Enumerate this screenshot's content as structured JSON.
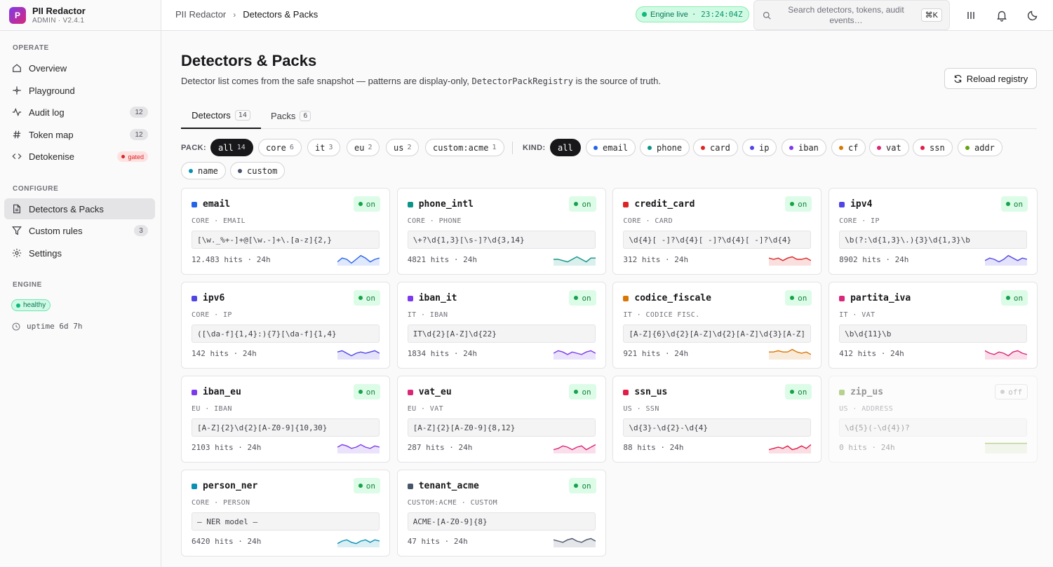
{
  "app": {
    "name": "PII Redactor",
    "version": "ADMIN · V2.4.1",
    "logo_letter": "P"
  },
  "sidebar": {
    "sections": [
      {
        "title": "OPERATE",
        "items": [
          {
            "label": "Overview",
            "icon": "home-icon"
          },
          {
            "label": "Playground",
            "icon": "sparkle-icon"
          },
          {
            "label": "Audit log",
            "icon": "activity-icon",
            "count": "12"
          },
          {
            "label": "Token map",
            "icon": "hash-icon",
            "count": "12"
          },
          {
            "label": "Detokenise",
            "icon": "code-icon",
            "badge": "gated"
          }
        ]
      },
      {
        "title": "CONFIGURE",
        "items": [
          {
            "label": "Detectors & Packs",
            "icon": "file-icon",
            "active": true
          },
          {
            "label": "Custom rules",
            "icon": "filter-icon",
            "count": "3"
          },
          {
            "label": "Settings",
            "icon": "gear-icon"
          }
        ]
      },
      {
        "title": "ENGINE"
      }
    ],
    "engine_status": "healthy",
    "uptime": "uptime 6d 7h"
  },
  "topbar": {
    "breadcrumb": [
      "PII Redactor",
      "Detectors & Packs"
    ],
    "engine_label": "Engine live",
    "engine_time": "· 23:24:04Z",
    "search_placeholder": "Search detectors, tokens, audit events…",
    "search_shortcut": "⌘K"
  },
  "page": {
    "title": "Detectors & Packs",
    "desc_before": "Detector list comes from the safe snapshot — patterns are display-only, ",
    "desc_code": "DetectorPackRegistry",
    "desc_after": " is the source of truth.",
    "reload_label": "Reload registry",
    "tabs": [
      {
        "label": "Detectors",
        "count": "14"
      },
      {
        "label": "Packs",
        "count": "6"
      }
    ]
  },
  "filters": {
    "pack_label": "PACK:",
    "kind_label": "KIND:",
    "packs": [
      {
        "label": "all",
        "count": "14",
        "active": true
      },
      {
        "label": "core",
        "count": "6"
      },
      {
        "label": "it",
        "count": "3"
      },
      {
        "label": "eu",
        "count": "2"
      },
      {
        "label": "us",
        "count": "2"
      },
      {
        "label": "custom:acme",
        "count": "1"
      }
    ],
    "kinds": [
      {
        "label": "all",
        "active": true
      },
      {
        "label": "email",
        "color": "#2563eb"
      },
      {
        "label": "phone",
        "color": "#0d9488"
      },
      {
        "label": "card",
        "color": "#dc2626"
      },
      {
        "label": "ip",
        "color": "#4f46e5"
      },
      {
        "label": "iban",
        "color": "#7c3aed"
      },
      {
        "label": "cf",
        "color": "#d97706"
      },
      {
        "label": "vat",
        "color": "#db2777"
      },
      {
        "label": "ssn",
        "color": "#e11d48"
      },
      {
        "label": "addr",
        "color": "#65a30d"
      },
      {
        "label": "name",
        "color": "#0891b2"
      },
      {
        "label": "custom",
        "color": "#475569"
      }
    ]
  },
  "detectors": [
    {
      "name": "email",
      "meta": "CORE · EMAIL",
      "pattern": "[\\w._%+-]+@[\\w.-]+\\.[a-z]{2,}",
      "hits": "12.483 hits · 24h",
      "status": "on",
      "color": "#2563eb",
      "spark": [
        0.3,
        0.6,
        0.5,
        0.2,
        0.5,
        0.8,
        0.6,
        0.3,
        0.5,
        0.6
      ]
    },
    {
      "name": "phone_intl",
      "meta": "CORE · PHONE",
      "pattern": "\\+?\\d{1,3}[\\s-]?\\d{3,14}",
      "hits": "4821 hits · 24h",
      "status": "on",
      "color": "#0d9488",
      "spark": [
        0.5,
        0.5,
        0.4,
        0.3,
        0.5,
        0.7,
        0.5,
        0.3,
        0.6,
        0.6
      ]
    },
    {
      "name": "credit_card",
      "meta": "CORE · CARD",
      "pattern": "\\d{4}[ -]?\\d{4}[ -]?\\d{4}[ -]?\\d{4}",
      "hits": "312 hits · 24h",
      "status": "on",
      "color": "#dc2626",
      "spark": [
        0.6,
        0.5,
        0.6,
        0.4,
        0.6,
        0.7,
        0.5,
        0.5,
        0.6,
        0.4
      ]
    },
    {
      "name": "ipv4",
      "meta": "CORE · IP",
      "pattern": "\\b(?:\\d{1,3}\\.){3}\\d{1,3}\\b",
      "hits": "8902 hits · 24h",
      "status": "on",
      "color": "#4f46e5",
      "spark": [
        0.4,
        0.6,
        0.5,
        0.3,
        0.5,
        0.8,
        0.6,
        0.4,
        0.6,
        0.5
      ]
    },
    {
      "name": "ipv6",
      "meta": "CORE · IP",
      "pattern": "([\\da-f]{1,4}:){7}[\\da-f]{1,4}",
      "hits": "142 hits · 24h",
      "status": "on",
      "color": "#4f46e5",
      "spark": [
        0.6,
        0.7,
        0.5,
        0.3,
        0.5,
        0.6,
        0.5,
        0.6,
        0.7,
        0.5
      ]
    },
    {
      "name": "iban_it",
      "meta": "IT · IBAN",
      "pattern": "IT\\d{2}[A-Z]\\d{22}",
      "hits": "1834 hits · 24h",
      "status": "on",
      "color": "#7c3aed",
      "spark": [
        0.5,
        0.7,
        0.6,
        0.4,
        0.6,
        0.5,
        0.4,
        0.6,
        0.7,
        0.5
      ]
    },
    {
      "name": "codice_fiscale",
      "meta": "IT · CODICE FISC.",
      "pattern": "[A-Z]{6}\\d{2}[A-Z]\\d{2}[A-Z]\\d{3}[A-Z]",
      "hits": "921 hits · 24h",
      "status": "on",
      "color": "#d97706",
      "spark": [
        0.6,
        0.6,
        0.7,
        0.6,
        0.6,
        0.8,
        0.6,
        0.5,
        0.6,
        0.4
      ]
    },
    {
      "name": "partita_iva",
      "meta": "IT · VAT",
      "pattern": "\\b\\d{11}\\b",
      "hits": "412 hits · 24h",
      "status": "on",
      "color": "#db2777",
      "spark": [
        0.7,
        0.5,
        0.4,
        0.6,
        0.5,
        0.3,
        0.6,
        0.7,
        0.5,
        0.4
      ]
    },
    {
      "name": "iban_eu",
      "meta": "EU · IBAN",
      "pattern": "[A-Z]{2}\\d{2}[A-Z0-9]{10,30}",
      "hits": "2103 hits · 24h",
      "status": "on",
      "color": "#7c3aed",
      "spark": [
        0.5,
        0.7,
        0.6,
        0.4,
        0.5,
        0.7,
        0.5,
        0.4,
        0.6,
        0.5
      ]
    },
    {
      "name": "vat_eu",
      "meta": "EU · VAT",
      "pattern": "[A-Z]{2}[A-Z0-9]{8,12}",
      "hits": "287 hits · 24h",
      "status": "on",
      "color": "#db2777",
      "spark": [
        0.3,
        0.4,
        0.6,
        0.5,
        0.3,
        0.5,
        0.6,
        0.3,
        0.5,
        0.7
      ]
    },
    {
      "name": "ssn_us",
      "meta": "US · SSN",
      "pattern": "\\d{3}-\\d{2}-\\d{4}",
      "hits": "88 hits · 24h",
      "status": "on",
      "color": "#e11d48",
      "spark": [
        0.3,
        0.4,
        0.5,
        0.4,
        0.6,
        0.3,
        0.4,
        0.6,
        0.4,
        0.7
      ]
    },
    {
      "name": "zip_us",
      "meta": "US · ADDRESS",
      "pattern": "\\d{5}(-\\d{4})?",
      "hits": "0 hits · 24h",
      "status": "off",
      "color": "#65a30d",
      "spark": [
        0.8,
        0.8,
        0.8,
        0.8,
        0.8,
        0.8,
        0.8,
        0.8,
        0.8,
        0.8
      ]
    },
    {
      "name": "person_ner",
      "meta": "CORE · PERSON",
      "pattern": "— NER model —",
      "hits": "6420 hits · 24h",
      "status": "on",
      "color": "#0891b2",
      "spark": [
        0.3,
        0.5,
        0.6,
        0.4,
        0.3,
        0.5,
        0.6,
        0.4,
        0.6,
        0.5
      ]
    },
    {
      "name": "tenant_acme",
      "meta": "CUSTOM:ACME · CUSTOM",
      "pattern": "ACME-[A-Z0-9]{8}",
      "hits": "47 hits · 24h",
      "status": "on",
      "color": "#475569",
      "spark": [
        0.6,
        0.5,
        0.4,
        0.6,
        0.7,
        0.5,
        0.4,
        0.6,
        0.7,
        0.5
      ]
    }
  ]
}
